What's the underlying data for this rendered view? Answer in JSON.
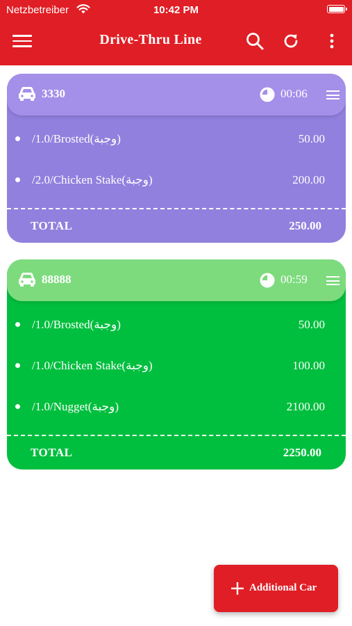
{
  "status_bar": {
    "carrier": "Netzbetreiber",
    "time": "10:42 PM"
  },
  "app_bar": {
    "title": "Drive-Thru Line"
  },
  "colors": {
    "brand": "#e01e25",
    "card1_header": "#a48fe9",
    "card1_body": "#9280de",
    "card2_header": "#7ddb7d",
    "card2_body": "#00bf3e"
  },
  "cards": [
    {
      "car_number": "3330",
      "timer": "00:06",
      "items": [
        {
          "name": "/1.0/Brosted(وجبة)",
          "price": "50.00"
        },
        {
          "name": "/2.0/Chicken Stake(وجبة)",
          "price": "200.00"
        }
      ],
      "total_label": "TOTAL",
      "total": "250.00"
    },
    {
      "car_number": "88888",
      "timer": "00:59",
      "items": [
        {
          "name": "/1.0/Brosted(وجبة)",
          "price": "50.00"
        },
        {
          "name": "/1.0/Chicken Stake(وجبة)",
          "price": "100.00"
        },
        {
          "name": "/1.0/Nugget(وجبة)",
          "price": "2100.00"
        }
      ],
      "total_label": "TOTAL",
      "total": "2250.00"
    }
  ],
  "fab": {
    "label": "Additional Car"
  }
}
